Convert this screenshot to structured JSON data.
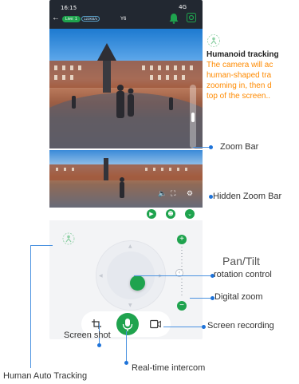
{
  "status_bar": {
    "time": "16:15",
    "network": "4G",
    "live_label": "Live: 1",
    "rate": "123KB/s",
    "device_name": "Y6"
  },
  "video_tools": {
    "volume_icon": "speaker-icon",
    "fullscreen_icon": "fullscreen-icon",
    "settings_icon": "gear-icon"
  },
  "icon_row": [
    "play-icon",
    "tracking-person-icon",
    "chevron-down-icon"
  ],
  "annotations": {
    "tracking_title": "Humanoid tracking",
    "tracking_lines": [
      "The camera will ac",
      "human-shaped tra",
      "zooming in, then d",
      "top of the screen.."
    ],
    "zoom_bar": "Zoom Bar",
    "hidden_zoom_bar": "Hidden Zoom Bar",
    "pan_tilt": "Pan/Tilt",
    "rotation_control": "rotation control",
    "digital_zoom": "Digital zoom",
    "screen_recording": "Screen recording",
    "screen_shot": "Screen shot",
    "realtime_intercom": "Real-time intercom",
    "human_auto_tracking": "Human Auto Tracking"
  },
  "colors": {
    "accent": "#1fa34e",
    "annotation_line": "#4a92e0",
    "annotation_dot": "#1e73d9",
    "tracking_text": "#ff8a00"
  }
}
